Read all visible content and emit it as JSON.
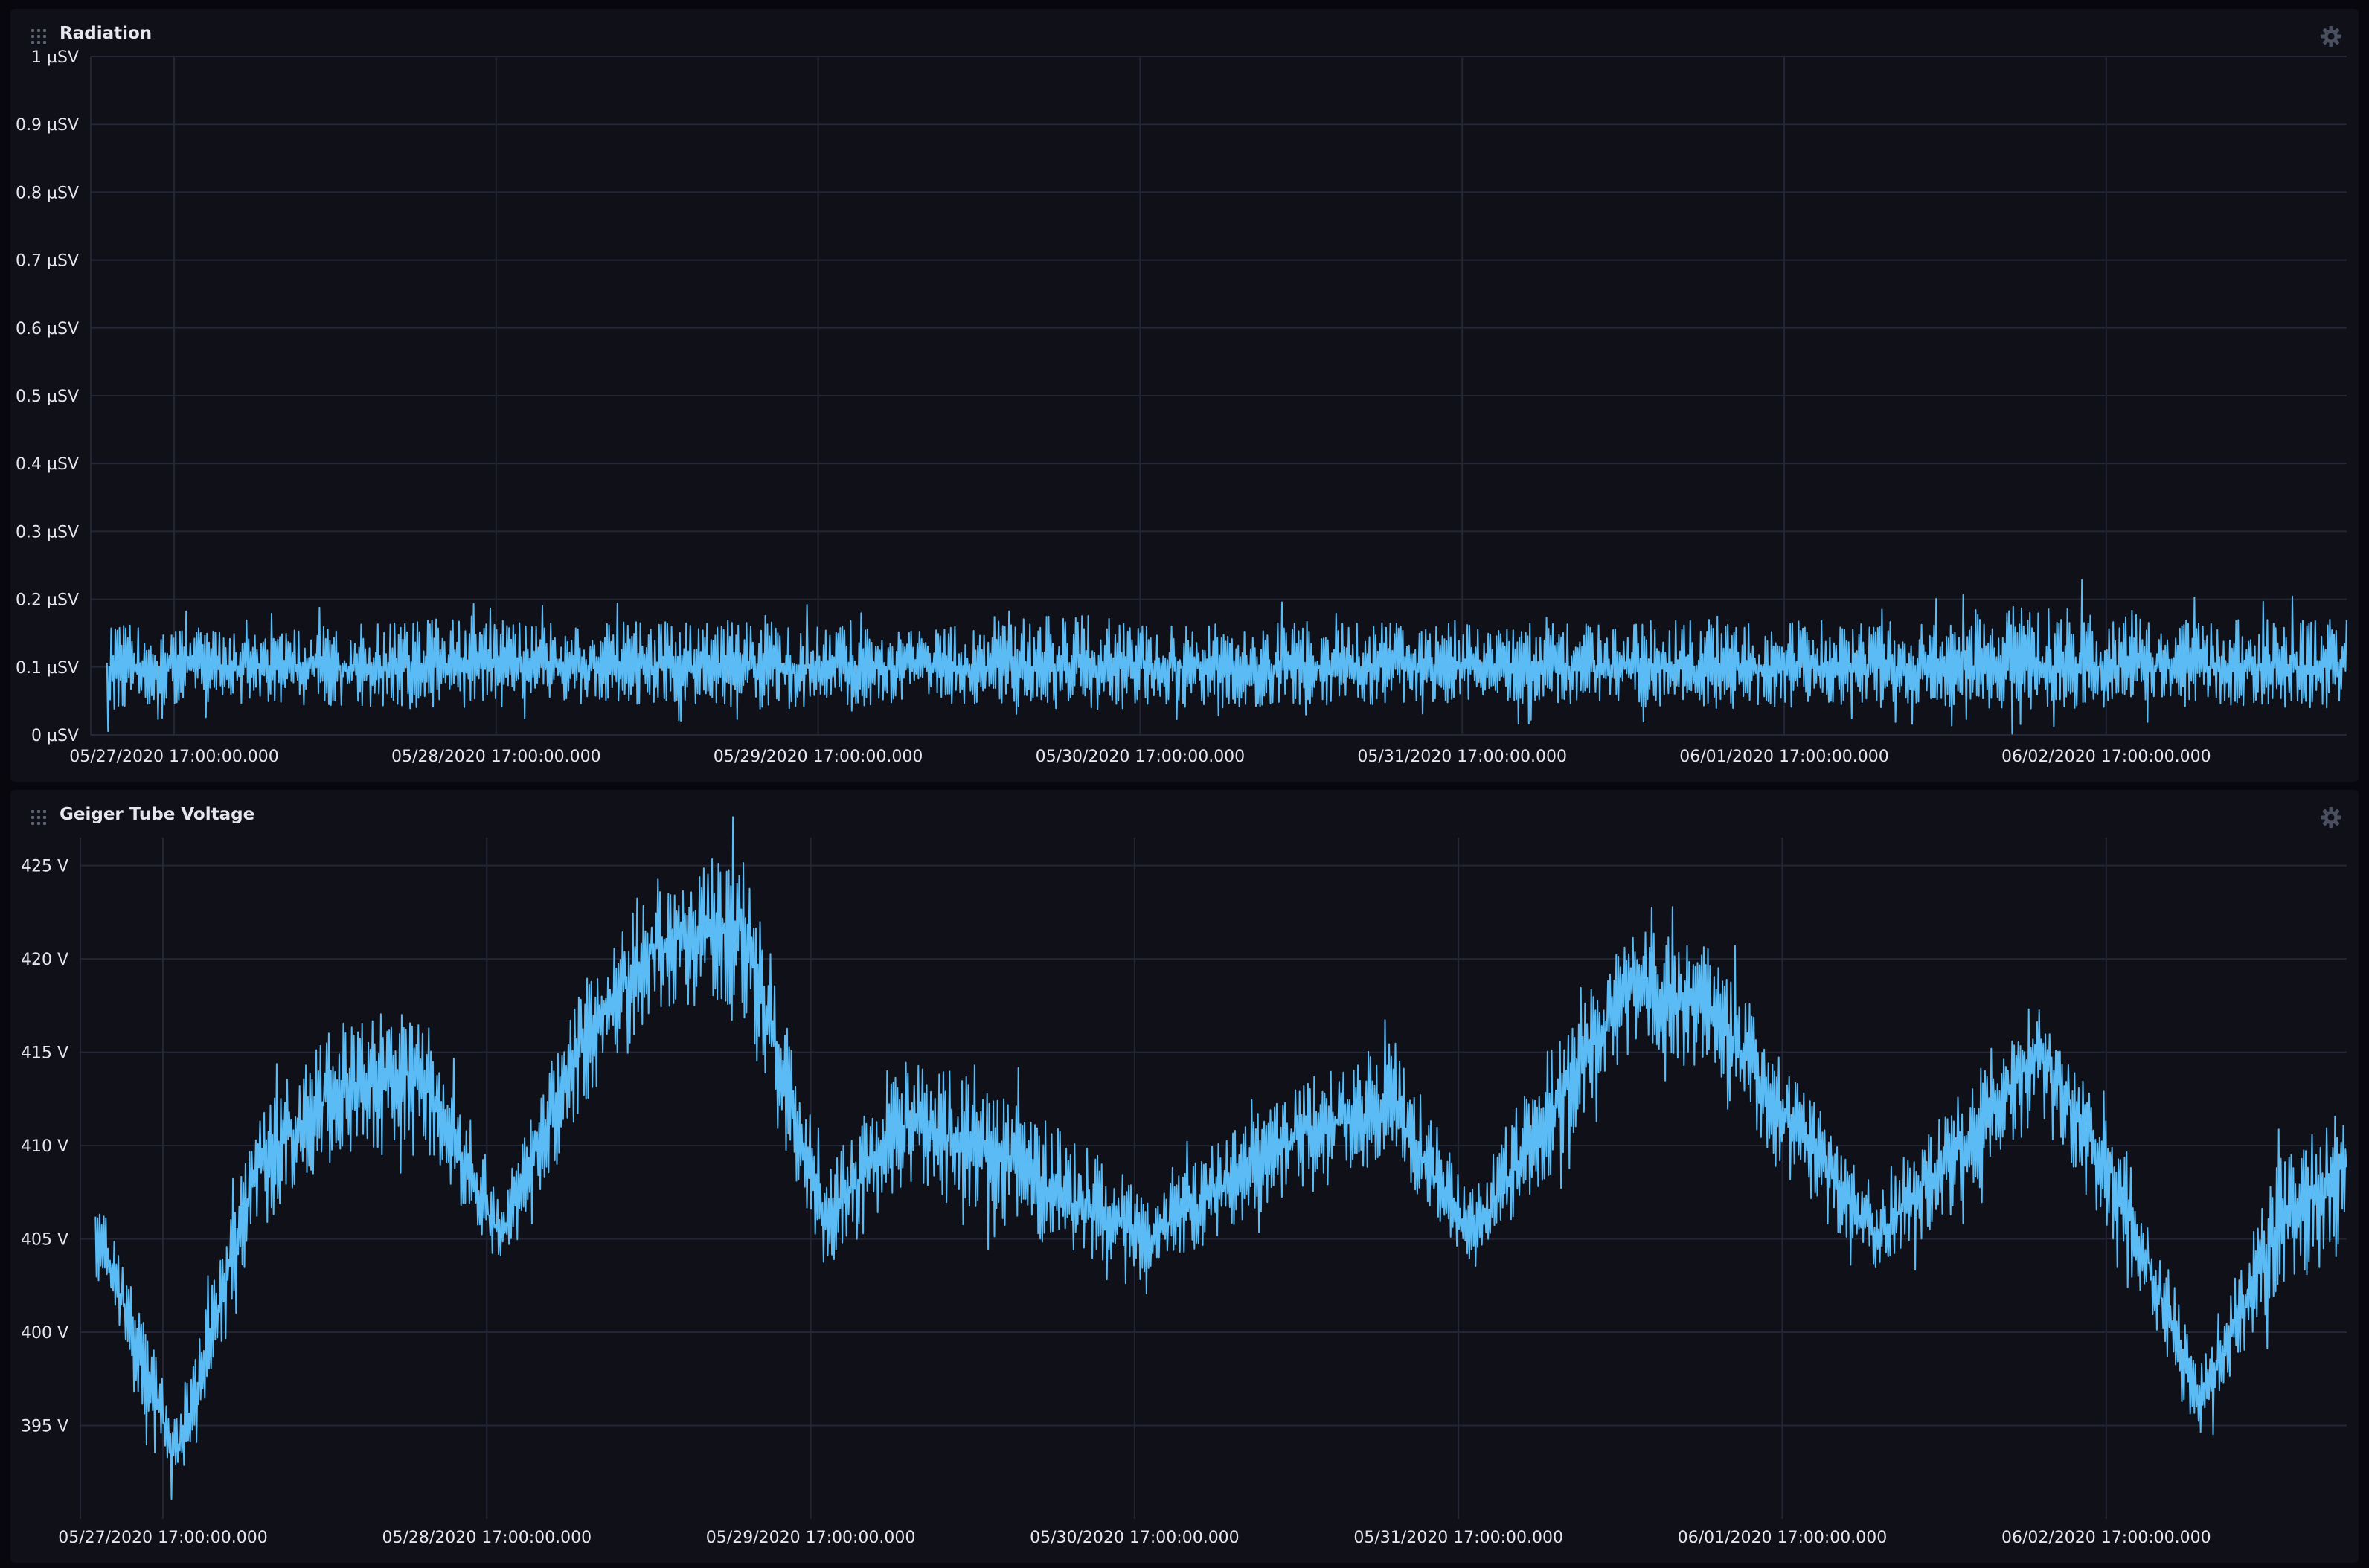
{
  "colors": {
    "background": "#07070d",
    "panel": "#101018",
    "grid": "#232634",
    "series": "#5bbcf5",
    "text": "#e6e6ef"
  },
  "icons": {
    "drag": "drag-handle-icon",
    "settings": "gear-icon"
  },
  "cells": [
    {
      "title": "Radiation"
    },
    {
      "title": "Geiger Tube Voltage"
    }
  ],
  "chart_data": [
    {
      "type": "line",
      "title": "Radiation",
      "xlabel": "",
      "ylabel": "",
      "x_ticks": [
        "05/27/2020 17:00:00.000",
        "05/28/2020 17:00:00.000",
        "05/29/2020 17:00:00.000",
        "05/30/2020 17:00:00.000",
        "05/31/2020 17:00:00.000",
        "06/01/2020 17:00:00.000",
        "06/02/2020 17:00:00.000"
      ],
      "y_ticks": [
        "0 µSV",
        "0.1 µSV",
        "0.2 µSV",
        "0.3 µSV",
        "0.4 µSV",
        "0.5 µSV",
        "0.6 µSV",
        "0.7 µSV",
        "0.8 µSV",
        "0.9 µSV",
        "1 µSV"
      ],
      "ylim": [
        0,
        1
      ],
      "unit": "µSV",
      "grid": true,
      "series": [
        {
          "x": [
            "05/27 12:00",
            "05/28 00:00",
            "05/28 12:00",
            "05/29 00:00",
            "05/29 12:00",
            "05/30 00:00",
            "05/30 12:00",
            "05/31 00:00",
            "05/31 12:00",
            "06/01 00:00",
            "06/01 12:00",
            "06/02 00:00",
            "06/02 12:00",
            "06/03 00:00",
            "06/03 12:00"
          ],
          "values": [
            0.1,
            0.1,
            0.1,
            0.1,
            0.1,
            0.1,
            0.1,
            0.1,
            0.1,
            0.1,
            0.1,
            0.1,
            0.1,
            0.1,
            0.1
          ],
          "band_min": [
            0.03,
            0.04,
            0.03,
            0.04,
            0.03,
            0.04,
            0.03,
            0.03,
            0.04,
            0.04,
            0.03,
            0.04,
            0.03,
            0.04,
            0.03
          ],
          "band_max": [
            0.17,
            0.16,
            0.18,
            0.17,
            0.18,
            0.16,
            0.19,
            0.17,
            0.18,
            0.17,
            0.18,
            0.17,
            0.21,
            0.18,
            0.18
          ]
        }
      ]
    },
    {
      "type": "line",
      "title": "Geiger Tube Voltage",
      "xlabel": "",
      "ylabel": "",
      "x_ticks": [
        "05/27/2020 17:00:00.000",
        "05/28/2020 17:00:00.000",
        "05/29/2020 17:00:00.000",
        "05/30/2020 17:00:00.000",
        "05/31/2020 17:00:00.000",
        "06/01/2020 17:00:00.000",
        "06/02/2020 17:00:00.000"
      ],
      "y_ticks": [
        "395 V",
        "400 V",
        "405 V",
        "410 V",
        "415 V",
        "420 V",
        "425 V"
      ],
      "ylim": [
        390,
        426.5
      ],
      "unit": "V",
      "grid": true,
      "series": [
        {
          "x": [
            "05/27 12:00",
            "05/27 18:00",
            "05/28 00:00",
            "05/28 06:00",
            "05/28 12:00",
            "05/28 18:00",
            "05/29 00:00",
            "05/29 06:00",
            "05/29 12:00",
            "05/29 18:00",
            "05/30 00:00",
            "05/30 06:00",
            "05/30 12:00",
            "05/30 18:00",
            "05/31 00:00",
            "05/31 06:00",
            "05/31 12:00",
            "05/31 18:00",
            "06/01 00:00",
            "06/01 06:00",
            "06/01 12:00",
            "06/01 18:00",
            "06/02 00:00",
            "06/02 06:00",
            "06/02 12:00",
            "06/02 18:00",
            "06/03 00:00",
            "06/03 06:00",
            "06/03 12:00"
          ],
          "values": [
            406,
            393,
            409,
            413,
            414,
            405,
            416,
            421,
            422,
            406,
            411,
            410,
            407,
            405,
            408,
            411,
            412,
            405,
            412,
            419,
            417,
            411,
            405,
            410,
            415,
            408,
            396,
            406,
            410
          ],
          "band_min": [
            402,
            390,
            405,
            409,
            410,
            403,
            411,
            417,
            416,
            403,
            407,
            406,
            404,
            403,
            405,
            407,
            409,
            403,
            408,
            415,
            413,
            407,
            403,
            406,
            411,
            404,
            394,
            402,
            404
          ],
          "band_max": [
            408,
            396,
            412,
            417,
            418,
            408,
            419,
            425,
            426,
            409,
            415,
            414,
            411,
            408,
            411,
            414,
            416,
            408,
            416,
            422,
            421,
            414,
            408,
            413,
            417,
            411,
            399,
            410,
            413
          ]
        }
      ]
    }
  ]
}
